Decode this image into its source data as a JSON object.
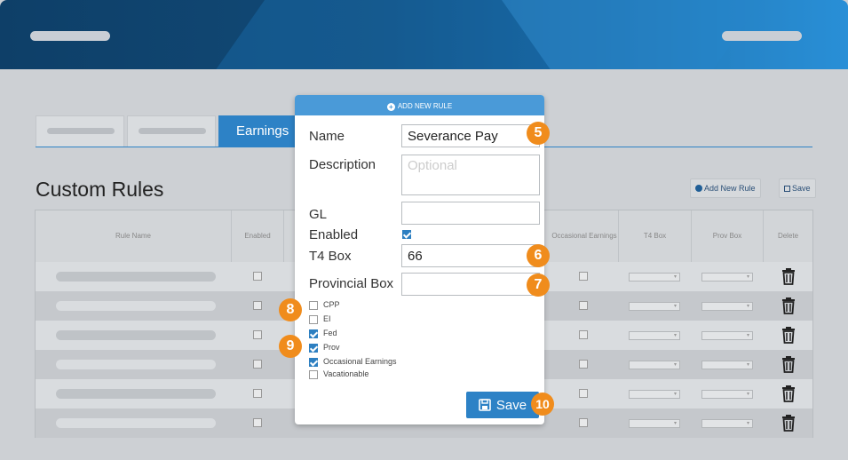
{
  "tabs": {
    "active_label": "Earnings"
  },
  "page": {
    "title": "Custom Rules",
    "add_rule_label": "Add New Rule",
    "save_label": "Save"
  },
  "table": {
    "headers": {
      "rule_name": "Rule Name",
      "enabled": "Enabled",
      "occasional": "Occasional Earnings",
      "t4_box": "T4 Box",
      "prov_box": "Prov Box",
      "delete": "Delete"
    }
  },
  "modal": {
    "header": "ADD NEW RULE",
    "name_label": "Name",
    "name_value": "Severance Pay",
    "description_label": "Description",
    "description_placeholder": "Optional",
    "gl_label": "GL",
    "gl_value": "",
    "enabled_label": "Enabled",
    "enabled_checked": true,
    "t4_label": "T4 Box",
    "t4_value": "66",
    "provincial_label": "Provincial Box",
    "provincial_value": "",
    "options": [
      {
        "label": "CPP",
        "checked": false
      },
      {
        "label": "EI",
        "checked": false
      },
      {
        "label": "Fed",
        "checked": true
      },
      {
        "label": "Prov",
        "checked": true
      },
      {
        "label": "Occasional Earnings",
        "checked": true
      },
      {
        "label": "Vacationable",
        "checked": false
      }
    ],
    "save_label": "Save"
  },
  "badges": [
    "5",
    "6",
    "7",
    "8",
    "9",
    "10"
  ],
  "colors": {
    "accent": "#2d82c6",
    "badge": "#f08c1c",
    "banner": "#114a77"
  }
}
